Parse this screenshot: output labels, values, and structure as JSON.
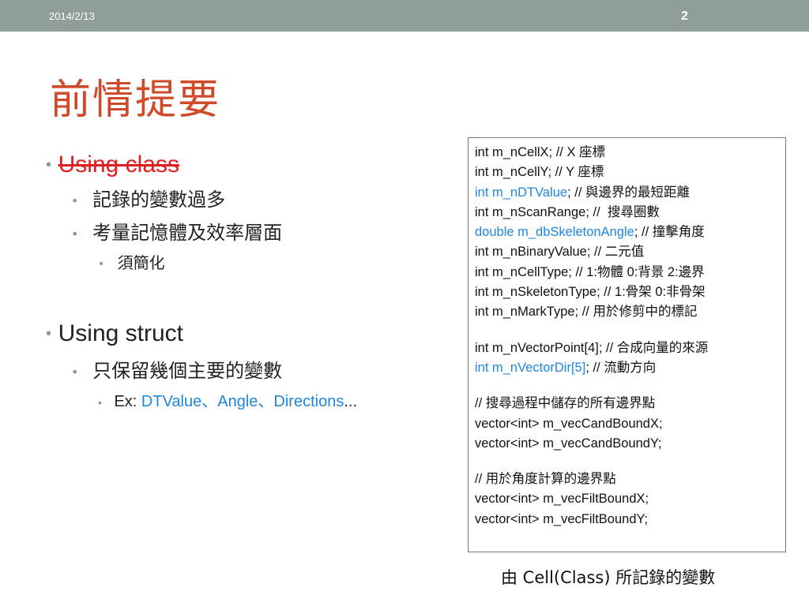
{
  "header": {
    "date": "2014/2/13",
    "page": "2"
  },
  "title": "前情提要",
  "bullets": {
    "using_class": "Using class",
    "class_sub1": "記錄的變數過多",
    "class_sub2": "考量記憶體及效率層面",
    "class_sub2_sub": "須簡化",
    "using_struct": "Using struct",
    "struct_sub1": "只保留幾個主要的變數",
    "ex_prefix": "Ex: ",
    "ex_blue": "DTValue、Angle、Directions",
    "ex_suffix": "..."
  },
  "code": {
    "l1": "int m_nCellX; // X 座標",
    "l2": "int m_nCellY; // Y 座標",
    "l3a": "int m_nDTValue",
    "l3b": "; // 與邊界的最短距離",
    "l4": "int m_nScanRange; //  搜尋圈數",
    "l5a": "double m_dbSkeletonAngle",
    "l5b": "; // 撞擊角度",
    "l6": "int m_nBinaryValue; // 二元值",
    "l7": "int m_nCellType; // 1:物體 0:背景 2:邊界",
    "l8": "int m_nSkeletonType; // 1:骨架 0:非骨架",
    "l9": "int m_nMarkType; // 用於修剪中的標記",
    "l10": "int m_nVectorPoint[4]; // 合成向量的來源",
    "l11a": "int m_nVectorDir[5]",
    "l11b": "; // 流動方向",
    "l12": "// 搜尋過程中儲存的所有邊界點",
    "l13": "vector<int> m_vecCandBoundX;",
    "l14": "vector<int> m_vecCandBoundY;",
    "l15": "// 用於角度計算的邊界點",
    "l16": "vector<int> m_vecFiltBoundX;",
    "l17": "vector<int> m_vecFiltBoundY;"
  },
  "caption": "由 Cell(Class) 所記錄的變數",
  "colors": {
    "title": "#cf4a28",
    "topbar": "#8f9e96",
    "highlight": "#1f86e0",
    "strike": "#e02020"
  }
}
